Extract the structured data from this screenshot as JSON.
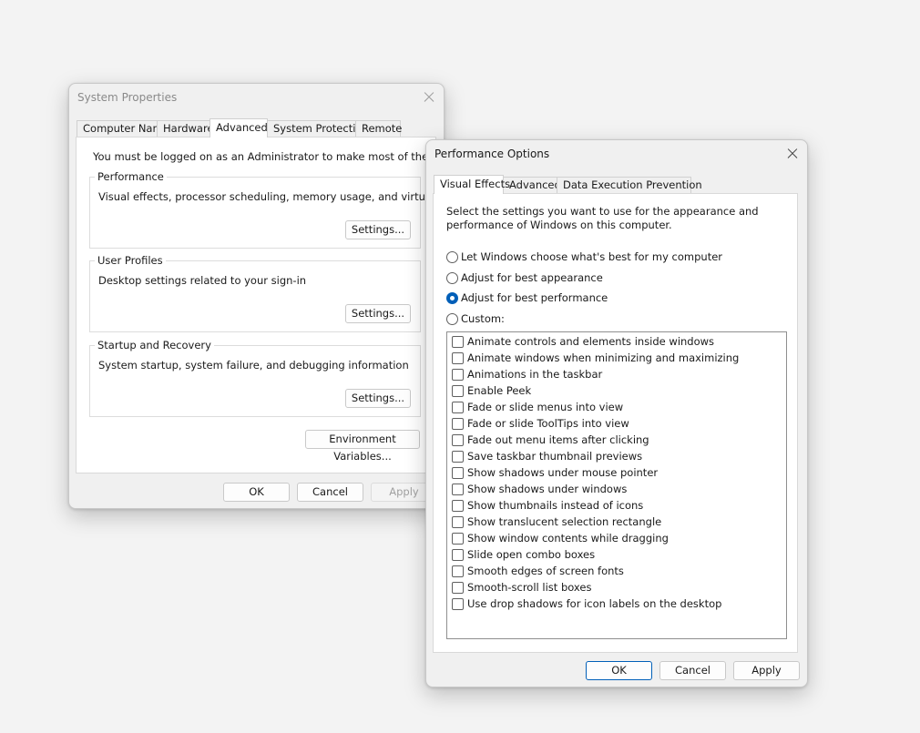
{
  "system_properties": {
    "title": "System Properties",
    "tabs": [
      "Computer Name",
      "Hardware",
      "Advanced",
      "System Protection",
      "Remote"
    ],
    "admin_note": "You must be logged on as an Administrator to make most of these changes.",
    "groups": {
      "performance": {
        "label": "Performance",
        "description": "Visual effects, processor scheduling, memory usage, and virtual memory",
        "button": "Settings..."
      },
      "user_profiles": {
        "label": "User Profiles",
        "description": "Desktop settings related to your sign-in",
        "button": "Settings..."
      },
      "startup_recovery": {
        "label": "Startup and Recovery",
        "description": "System startup, system failure, and debugging information",
        "button": "Settings..."
      }
    },
    "env_button": "Environment Variables...",
    "ok": "OK",
    "cancel": "Cancel",
    "apply": "Apply"
  },
  "performance_options": {
    "title": "Performance Options",
    "tabs": [
      "Visual Effects",
      "Advanced",
      "Data Execution Prevention"
    ],
    "intro_line1": "Select the settings you want to use for the appearance and",
    "intro_line2": "performance of Windows on this computer.",
    "radios": [
      "Let Windows choose what's best for my computer",
      "Adjust for best appearance",
      "Adjust for best performance",
      "Custom:"
    ],
    "selected_radio": "Adjust for best performance",
    "effects": [
      "Animate controls and elements inside windows",
      "Animate windows when minimizing and maximizing",
      "Animations in the taskbar",
      "Enable Peek",
      "Fade or slide menus into view",
      "Fade or slide ToolTips into view",
      "Fade out menu items after clicking",
      "Save taskbar thumbnail previews",
      "Show shadows under mouse pointer",
      "Show shadows under windows",
      "Show thumbnails instead of icons",
      "Show translucent selection rectangle",
      "Show window contents while dragging",
      "Slide open combo boxes",
      "Smooth edges of screen fonts",
      "Smooth-scroll list boxes",
      "Use drop shadows for icon labels on the desktop"
    ],
    "ok": "OK",
    "cancel": "Cancel",
    "apply": "Apply"
  }
}
